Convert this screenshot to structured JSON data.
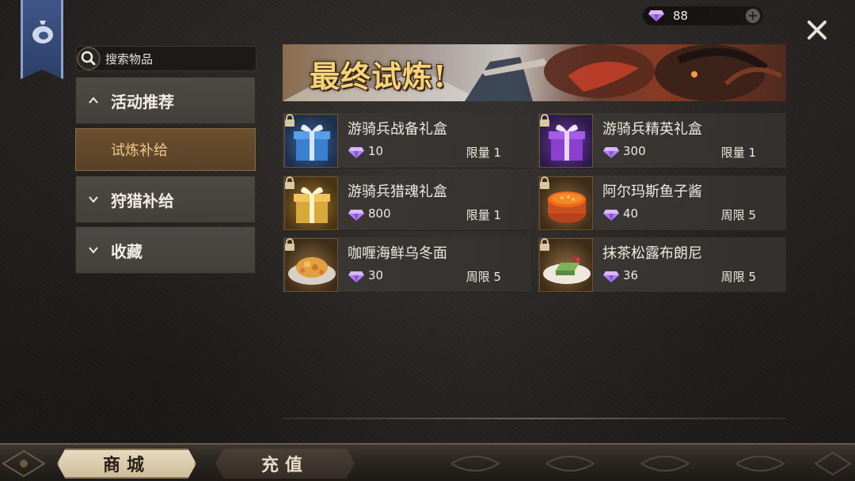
{
  "currency": {
    "amount": "88",
    "gem_icon": "diamond-gem-icon",
    "plus_label": "+"
  },
  "search": {
    "placeholder": "搜索物品"
  },
  "sidebar": {
    "items": [
      {
        "label": "活动推荐",
        "chevron": "up"
      },
      {
        "label": "试炼补给",
        "selected": true
      },
      {
        "label": "狩猎补给",
        "chevron": "down"
      },
      {
        "label": "收藏",
        "chevron": "down"
      }
    ]
  },
  "promo": {
    "title": "最终试炼!"
  },
  "items": [
    {
      "name": "游骑兵战备礼盒",
      "price": "10",
      "limit": "限量 1",
      "image": "blue-gift-box"
    },
    {
      "name": "游骑兵精英礼盒",
      "price": "300",
      "limit": "限量 1",
      "image": "purple-gift-box"
    },
    {
      "name": "游骑兵猎魂礼盒",
      "price": "800",
      "limit": "限量 1",
      "image": "gold-gift-box"
    },
    {
      "name": "阿尔玛斯鱼子酱",
      "price": "40",
      "limit": "周限 5",
      "image": "caviar-bowl"
    },
    {
      "name": "咖喱海鲜乌冬面",
      "price": "30",
      "limit": "周限 5",
      "image": "curry-noodle-plate"
    },
    {
      "name": "抹茶松露布朗尼",
      "price": "36",
      "limit": "周限 5",
      "image": "matcha-brownie-plate"
    }
  ],
  "bottom_tabs": [
    {
      "label": "商城",
      "active": true
    },
    {
      "label": "充值",
      "active": false
    }
  ],
  "colors": {
    "accent_gold": "#f0c98a",
    "gem_purple": "#b07cf0",
    "selected_bg": "#6a4f2f"
  }
}
